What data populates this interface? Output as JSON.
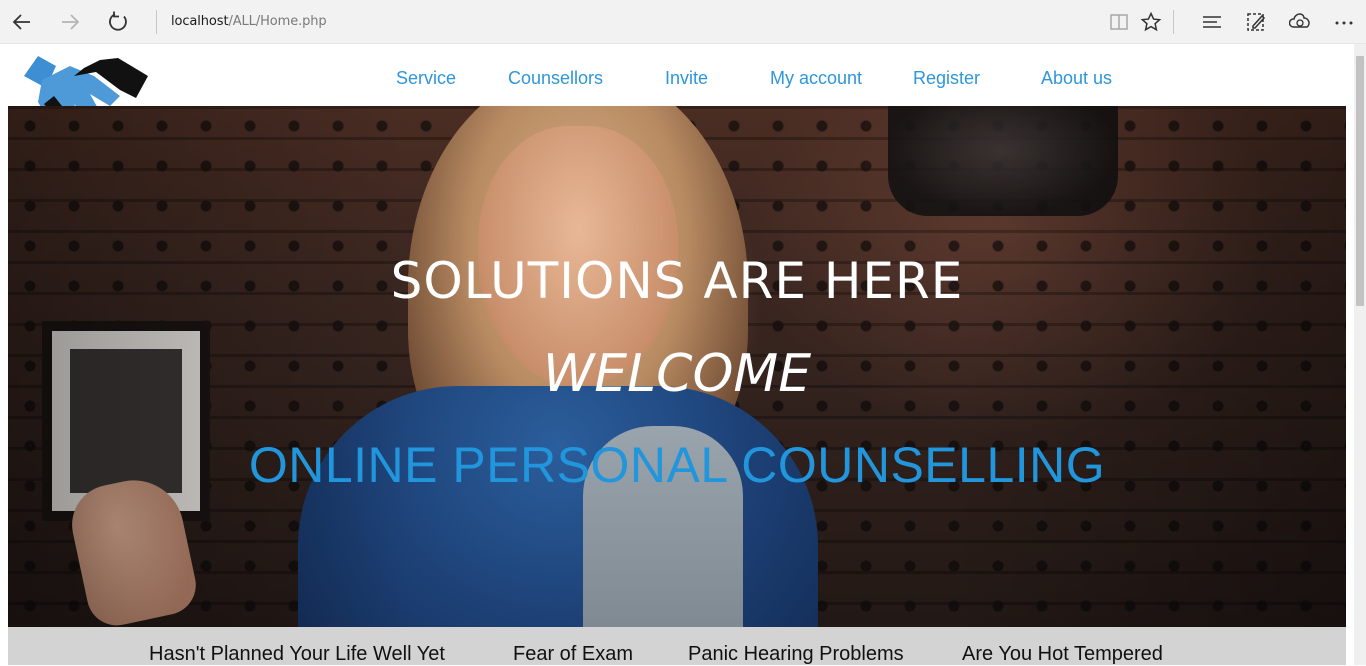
{
  "browser": {
    "url_host": "localhost",
    "url_path": "/ALL/Home.php",
    "icons": [
      "back-icon",
      "forward-icon",
      "refresh-icon",
      "reading-view-icon",
      "favorite-star-icon",
      "hub-icon",
      "web-note-icon",
      "share-icon",
      "more-icon"
    ]
  },
  "site": {
    "logo": "handshake-logo",
    "nav": [
      "Service",
      "Counsellors",
      "Invite",
      "My account",
      "Register",
      "About us"
    ],
    "accent_color": "#2e96db"
  },
  "hero": {
    "line1": "SOLUTIONS ARE HERE",
    "line2": "WELCOME",
    "line3": "ONLINE PERSONAL COUNSELLING"
  },
  "issues": [
    "Hasn't Planned Your Life Well Yet",
    "Fear of Exam",
    "Panic Hearing Problems",
    "Are You Hot Tempered"
  ]
}
